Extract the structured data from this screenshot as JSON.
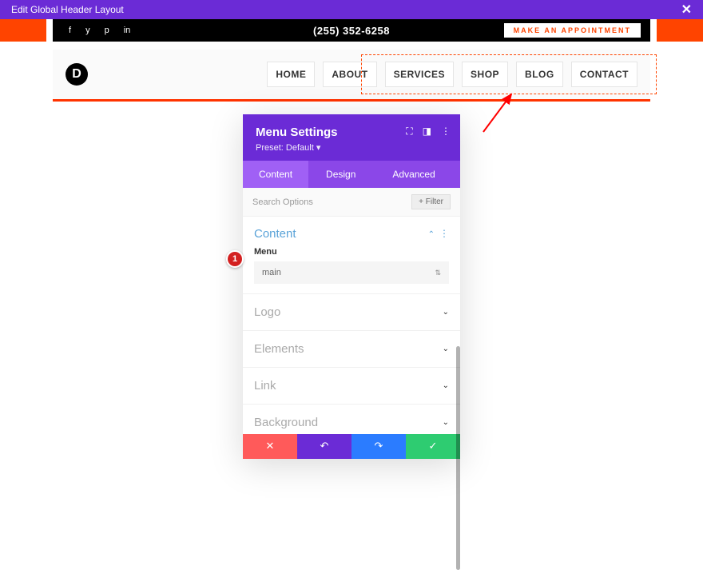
{
  "topbar": {
    "title": "Edit Global Header Layout",
    "close": "✕"
  },
  "header": {
    "phone": "(255) 352-6258",
    "appointment_label": "MAKE AN APPOINTMENT",
    "social": {
      "fb": "f",
      "tw": "y",
      "pin": "p",
      "in": "in"
    }
  },
  "nav": {
    "items": [
      "HOME",
      "ABOUT",
      "SERVICES",
      "SHOP",
      "BLOG",
      "CONTACT"
    ]
  },
  "panel": {
    "title": "Menu Settings",
    "preset": "Preset: Default ▾",
    "tabs": {
      "content": "Content",
      "design": "Design",
      "advanced": "Advanced"
    },
    "search_placeholder": "Search Options",
    "filter_label": "+  Filter",
    "sections": {
      "content": {
        "title": "Content",
        "field_label": "Menu",
        "select_value": "main"
      },
      "logo": "Logo",
      "elements": "Elements",
      "link": "Link",
      "background": "Background"
    }
  },
  "badge": "1",
  "colors": {
    "purple": "#6b2bd6",
    "orange": "#ff4400"
  }
}
